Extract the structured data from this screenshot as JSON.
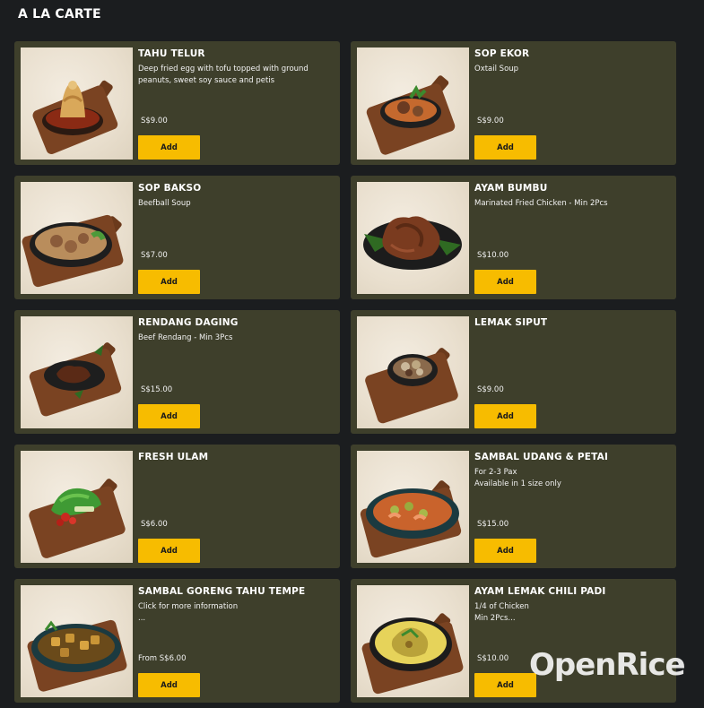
{
  "section": {
    "title": "A LA CARTE"
  },
  "items": [
    {
      "name": "TAHU TELUR",
      "desc": "Deep fried egg with tofu topped with ground peanuts, sweet soy sauce and petis",
      "price": "S$9.00",
      "add": "Add",
      "dish": "tahu-telur"
    },
    {
      "name": "SOP EKOR",
      "desc": "Oxtail Soup",
      "price": "S$9.00",
      "add": "Add",
      "dish": "sop-ekor"
    },
    {
      "name": "SOP BAKSO",
      "desc": "Beefball Soup",
      "price": "S$7.00",
      "add": "Add",
      "dish": "sop-bakso"
    },
    {
      "name": "AYAM BUMBU",
      "desc": "Marinated Fried Chicken - Min 2Pcs",
      "price": "S$10.00",
      "add": "Add",
      "dish": "ayam-bumbu"
    },
    {
      "name": "RENDANG DAGING",
      "desc": "Beef Rendang - Min 3Pcs",
      "price": "S$15.00",
      "add": "Add",
      "dish": "rendang"
    },
    {
      "name": "LEMAK SIPUT",
      "desc": "",
      "price": "S$9.00",
      "add": "Add",
      "dish": "lemak-siput"
    },
    {
      "name": "FRESH ULAM",
      "desc": "",
      "price": "S$6.00",
      "add": "Add",
      "dish": "fresh-ulam"
    },
    {
      "name": "SAMBAL UDANG & PETAI",
      "desc": "For 2-3 Pax\nAvailable in 1 size only",
      "price": "S$15.00",
      "add": "Add",
      "dish": "sambal-udang"
    },
    {
      "name": "SAMBAL GORENG TAHU TEMPE",
      "desc": "Click for more information\n...",
      "price": "From S$6.00",
      "add": "Add",
      "dish": "tahu-tempe"
    },
    {
      "name": "AYAM LEMAK CHILI PADI",
      "desc": "1/4 of Chicken\nMin 2Pcs...",
      "price": "S$10.00",
      "add": "Add",
      "dish": "ayam-lemak"
    }
  ],
  "watermark": {
    "text": "OpenRice"
  },
  "colors": {
    "card_bg": "#3e3f2b",
    "button": "#f7bc00",
    "page_bg": "#1b1d1f"
  }
}
